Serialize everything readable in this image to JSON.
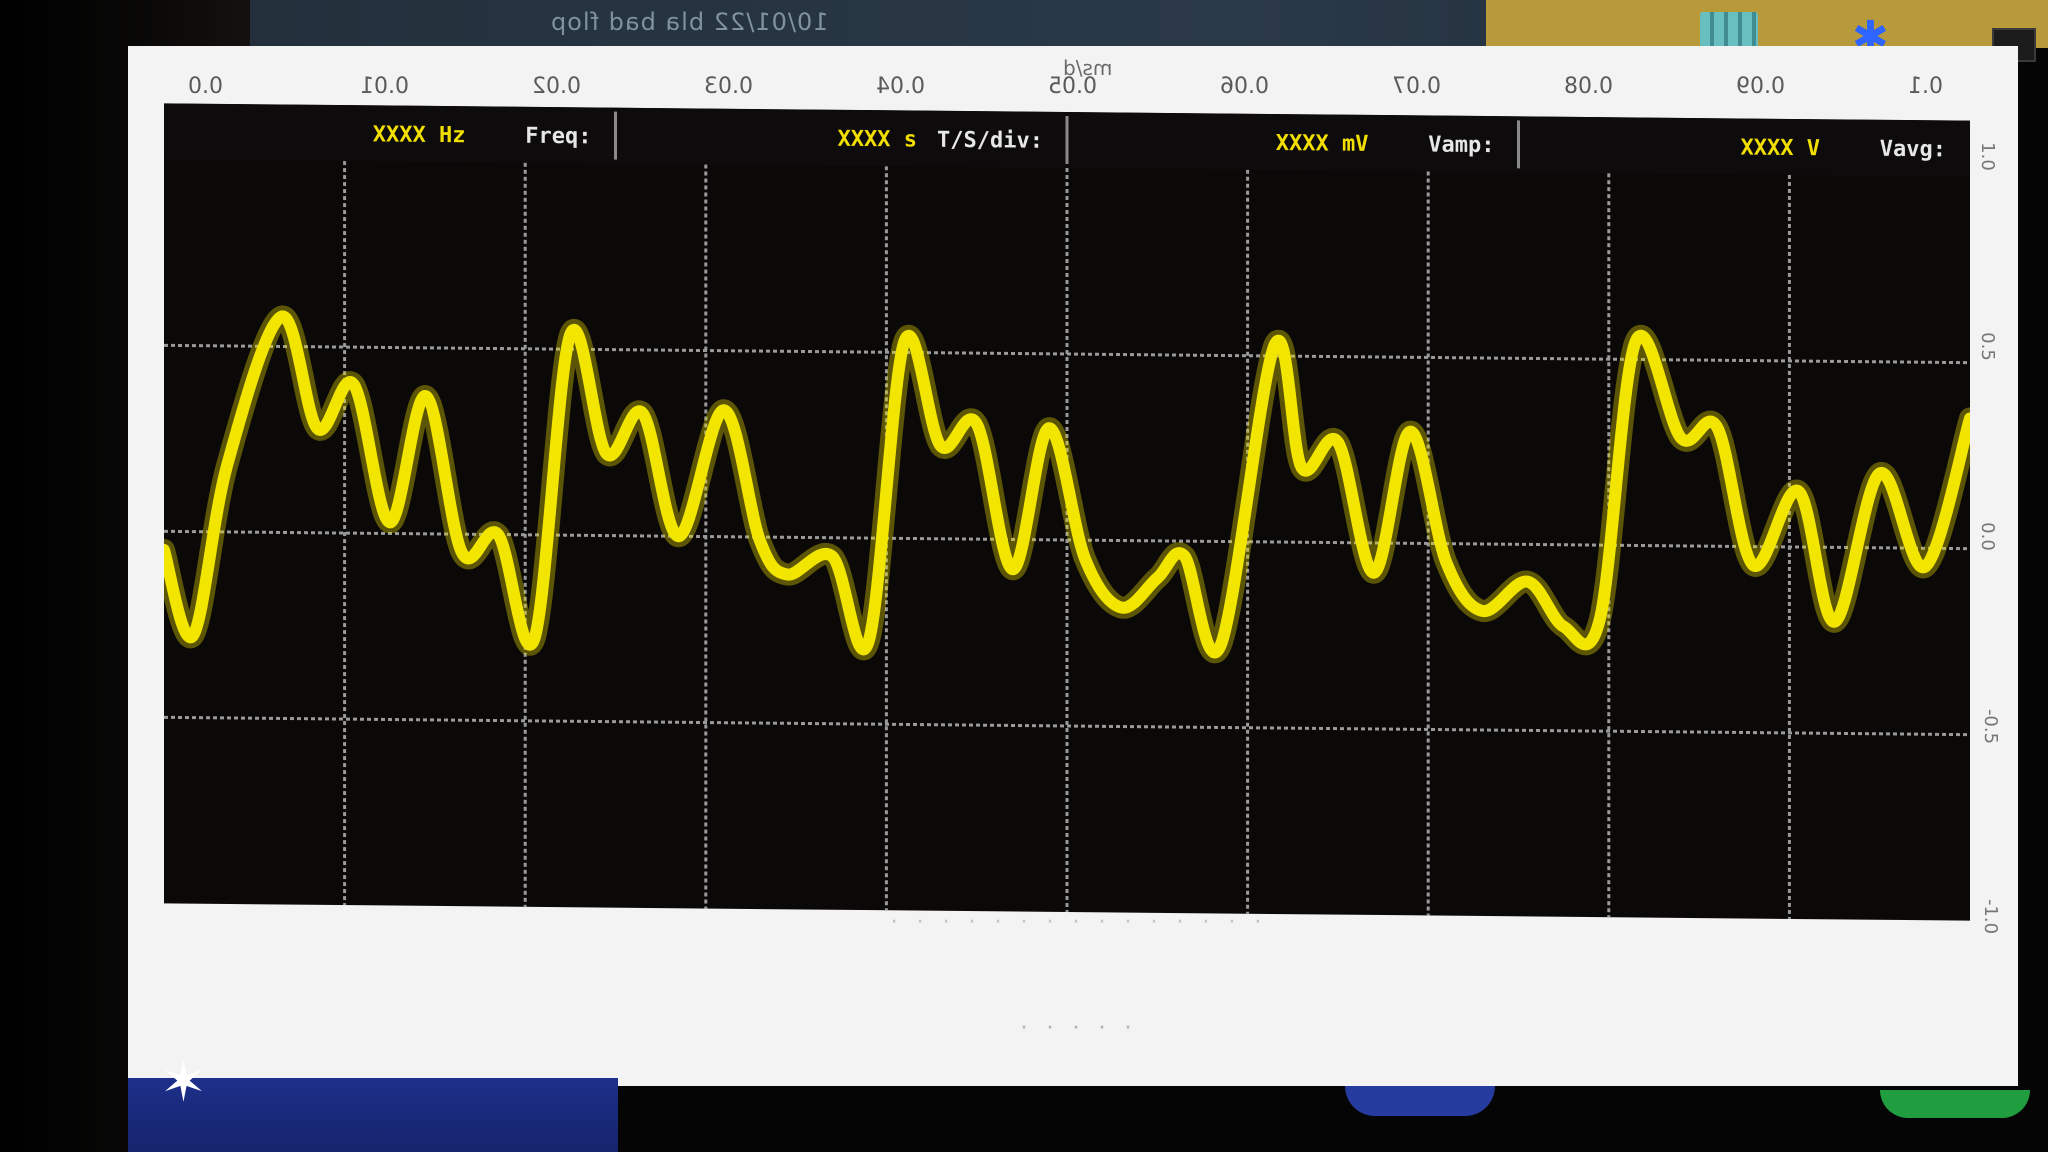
{
  "window": {
    "title": "10/01/22  bla bad flop",
    "top_axis_title": "ms/d",
    "footer_text_1": "· · · · · · · · · · · · · · ·",
    "footer_text_2": "· · · · ·"
  },
  "tray": {
    "icons": [
      "grid-icon",
      "star-icon",
      "box-icon"
    ],
    "accent": "#b89a3a"
  },
  "measurements": [
    {
      "label": "Freq:",
      "value": "XXXX Hz"
    },
    {
      "label": "T/S/div:",
      "value": "XXXX s"
    },
    {
      "label": "Vamp:",
      "value": "XXXX mV"
    },
    {
      "label": "Vavg:",
      "value": "XXXX V"
    }
  ],
  "top_ticks": [
    "0.0",
    "0.01",
    "0.02",
    "0.03",
    "0.04",
    "0.05",
    "0.06",
    "0.07",
    "0.08",
    "0.09",
    "0.1"
  ],
  "right_ticks": [
    "1.0",
    "0.5",
    "0.0",
    "-0.5",
    "-1.0"
  ],
  "chart_data": {
    "type": "line",
    "title": "",
    "xlabel": "",
    "ylabel": "",
    "grid": true,
    "xlim": [
      0,
      1
    ],
    "ylim": [
      -1,
      1
    ],
    "series": [
      {
        "color": "#f2e600",
        "x": [
          0.0,
          0.016,
          0.035,
          0.065,
          0.085,
          0.105,
          0.125,
          0.145,
          0.165,
          0.185,
          0.205,
          0.225,
          0.245,
          0.265,
          0.285,
          0.31,
          0.33,
          0.345,
          0.37,
          0.39,
          0.41,
          0.43,
          0.45,
          0.47,
          0.49,
          0.51,
          0.53,
          0.55,
          0.565,
          0.585,
          0.615,
          0.63,
          0.65,
          0.67,
          0.69,
          0.71,
          0.73,
          0.755,
          0.775,
          0.795,
          0.815,
          0.84,
          0.86,
          0.88,
          0.905,
          0.925,
          0.95,
          0.975,
          1.0
        ],
        "y": [
          -0.05,
          -0.28,
          0.18,
          0.58,
          0.28,
          0.4,
          0.03,
          0.37,
          -0.05,
          0.0,
          -0.28,
          0.54,
          0.22,
          0.33,
          0.0,
          0.34,
          -0.01,
          -0.1,
          -0.05,
          -0.28,
          0.53,
          0.25,
          0.31,
          -0.08,
          0.3,
          -0.05,
          -0.18,
          -0.1,
          -0.04,
          -0.28,
          0.53,
          0.2,
          0.27,
          -0.08,
          0.3,
          -0.05,
          -0.18,
          -0.1,
          -0.22,
          -0.2,
          0.55,
          0.29,
          0.32,
          -0.05,
          0.15,
          -0.2,
          0.2,
          -0.05,
          0.35
        ]
      }
    ]
  }
}
